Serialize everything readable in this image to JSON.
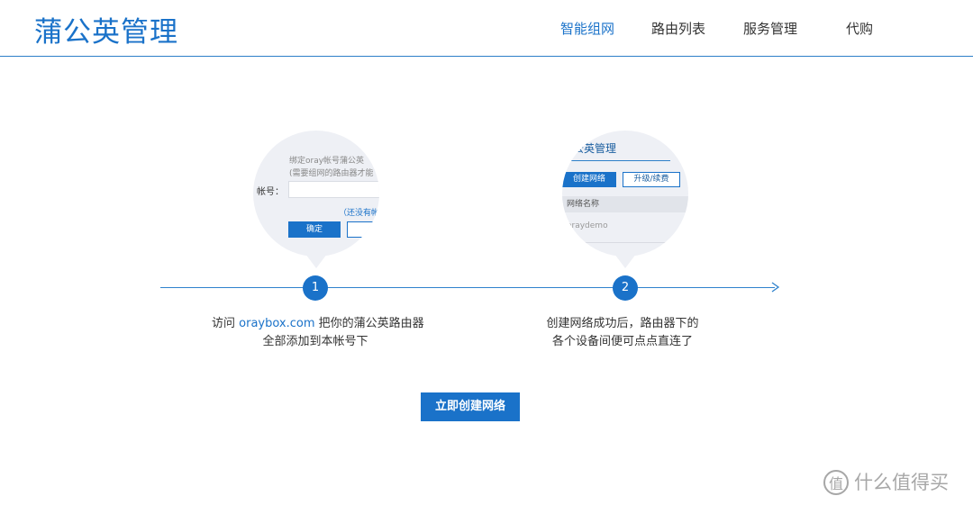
{
  "header": {
    "logo": "蒲公英管理",
    "nav": [
      {
        "label": "智能组网",
        "active": true
      },
      {
        "label": "路由列表",
        "active": false
      },
      {
        "label": "服务管理",
        "active": false
      },
      {
        "label": "代购",
        "active": false
      }
    ]
  },
  "steps": [
    {
      "number": "1",
      "caption_prefix": "访问 ",
      "caption_link": "oraybox.com",
      "caption_suffix": " 把你的蒲公英路由器",
      "caption_line2": "全部添加到本帐号下",
      "bubble": {
        "line1": "绑定oray帐号蒲公英",
        "line2": "(需要组网的路由器才能",
        "account_label": "帐号：",
        "link": "（还没有帐",
        "confirm": "确定"
      }
    },
    {
      "number": "2",
      "caption_line1": "创建网络成功后，路由器下的",
      "caption_line2": "各个设备间便可点点直连了",
      "bubble": {
        "title": "蒲公英管理",
        "create_btn": "创建网络",
        "upgrade_btn": "升级/续费",
        "col_header": "网络名称",
        "row_value": "oraydemo"
      }
    }
  ],
  "cta": "立即创建网络",
  "watermark": "什么值得买",
  "colors": {
    "accent": "#1a72c9",
    "bubble_bg": "#eef0f5"
  }
}
